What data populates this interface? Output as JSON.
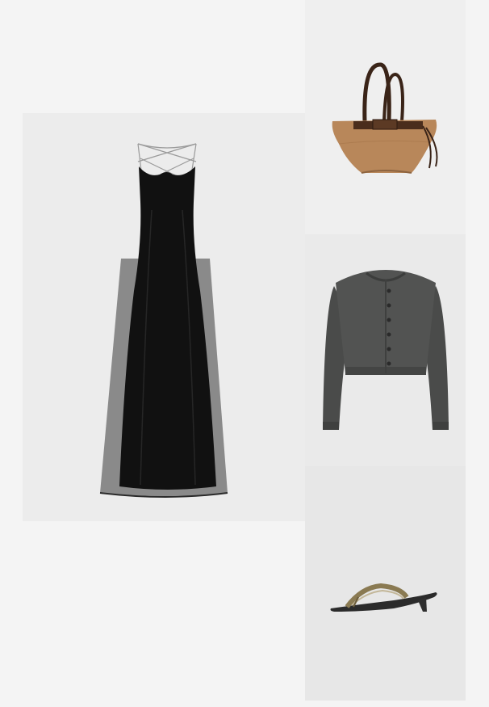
{
  "products": [
    {
      "id": "dress",
      "icon": "black-maxi-dress-icon"
    },
    {
      "id": "bag",
      "icon": "tan-suede-tote-bag-icon"
    },
    {
      "id": "cardigan",
      "icon": "charcoal-cropped-cardigan-icon"
    },
    {
      "id": "sandal",
      "icon": "thong-kitten-heel-sandal-icon"
    }
  ]
}
